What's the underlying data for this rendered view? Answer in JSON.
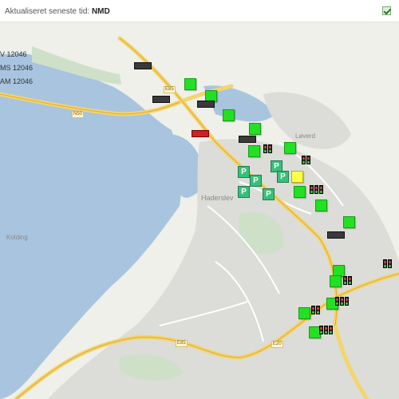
{
  "header": {
    "label_prefix": "Aktualiseret seneste tid:",
    "label_value": "NMD",
    "checkbox_checked": true
  },
  "legend": {
    "lines": [
      "V 12046",
      "MS 12046",
      "AM 12046"
    ]
  },
  "places": {
    "town": "Haderslev",
    "bay": "Kolding",
    "district": "Løverd"
  },
  "roads": {
    "r1": "N50",
    "r2": "E85",
    "r3": "E85",
    "r4": "E20"
  },
  "colors": {
    "water": "#a9c4de",
    "land": "#eef0e9",
    "urban": "#dcdcd8",
    "road_major": "#f3d56b",
    "marker_green": "#22e022",
    "marker_yellow": "#ffff4d",
    "marker_red": "#cc2222",
    "parking": "#38c07a"
  }
}
